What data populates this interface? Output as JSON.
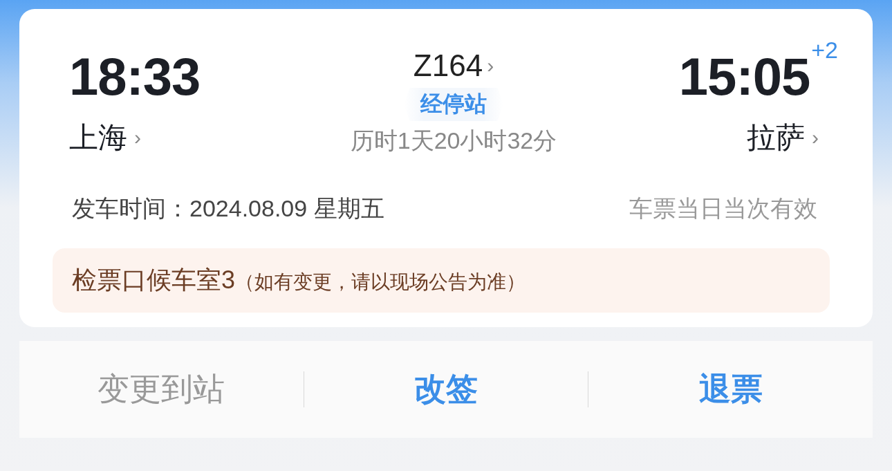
{
  "departure": {
    "time": "18:33",
    "station": "上海",
    "arrow": "›"
  },
  "train": {
    "number": "Z164",
    "arrow": "›",
    "badge": "经停站",
    "duration": "历时1天20小时32分"
  },
  "arrival": {
    "time": "15:05",
    "day_offset": "+2",
    "station": "拉萨",
    "arrow": "›"
  },
  "date_line": {
    "label": "发车时间：2024.08.09 星期五",
    "validity": "车票当日当次有效"
  },
  "notice": {
    "gate": "检票口候车室3",
    "note": "（如有变更，请以现场公告为准）"
  },
  "actions": [
    {
      "label": "变更到站",
      "disabled": true
    },
    {
      "label": "改签",
      "disabled": false
    },
    {
      "label": "退票",
      "disabled": false
    }
  ]
}
